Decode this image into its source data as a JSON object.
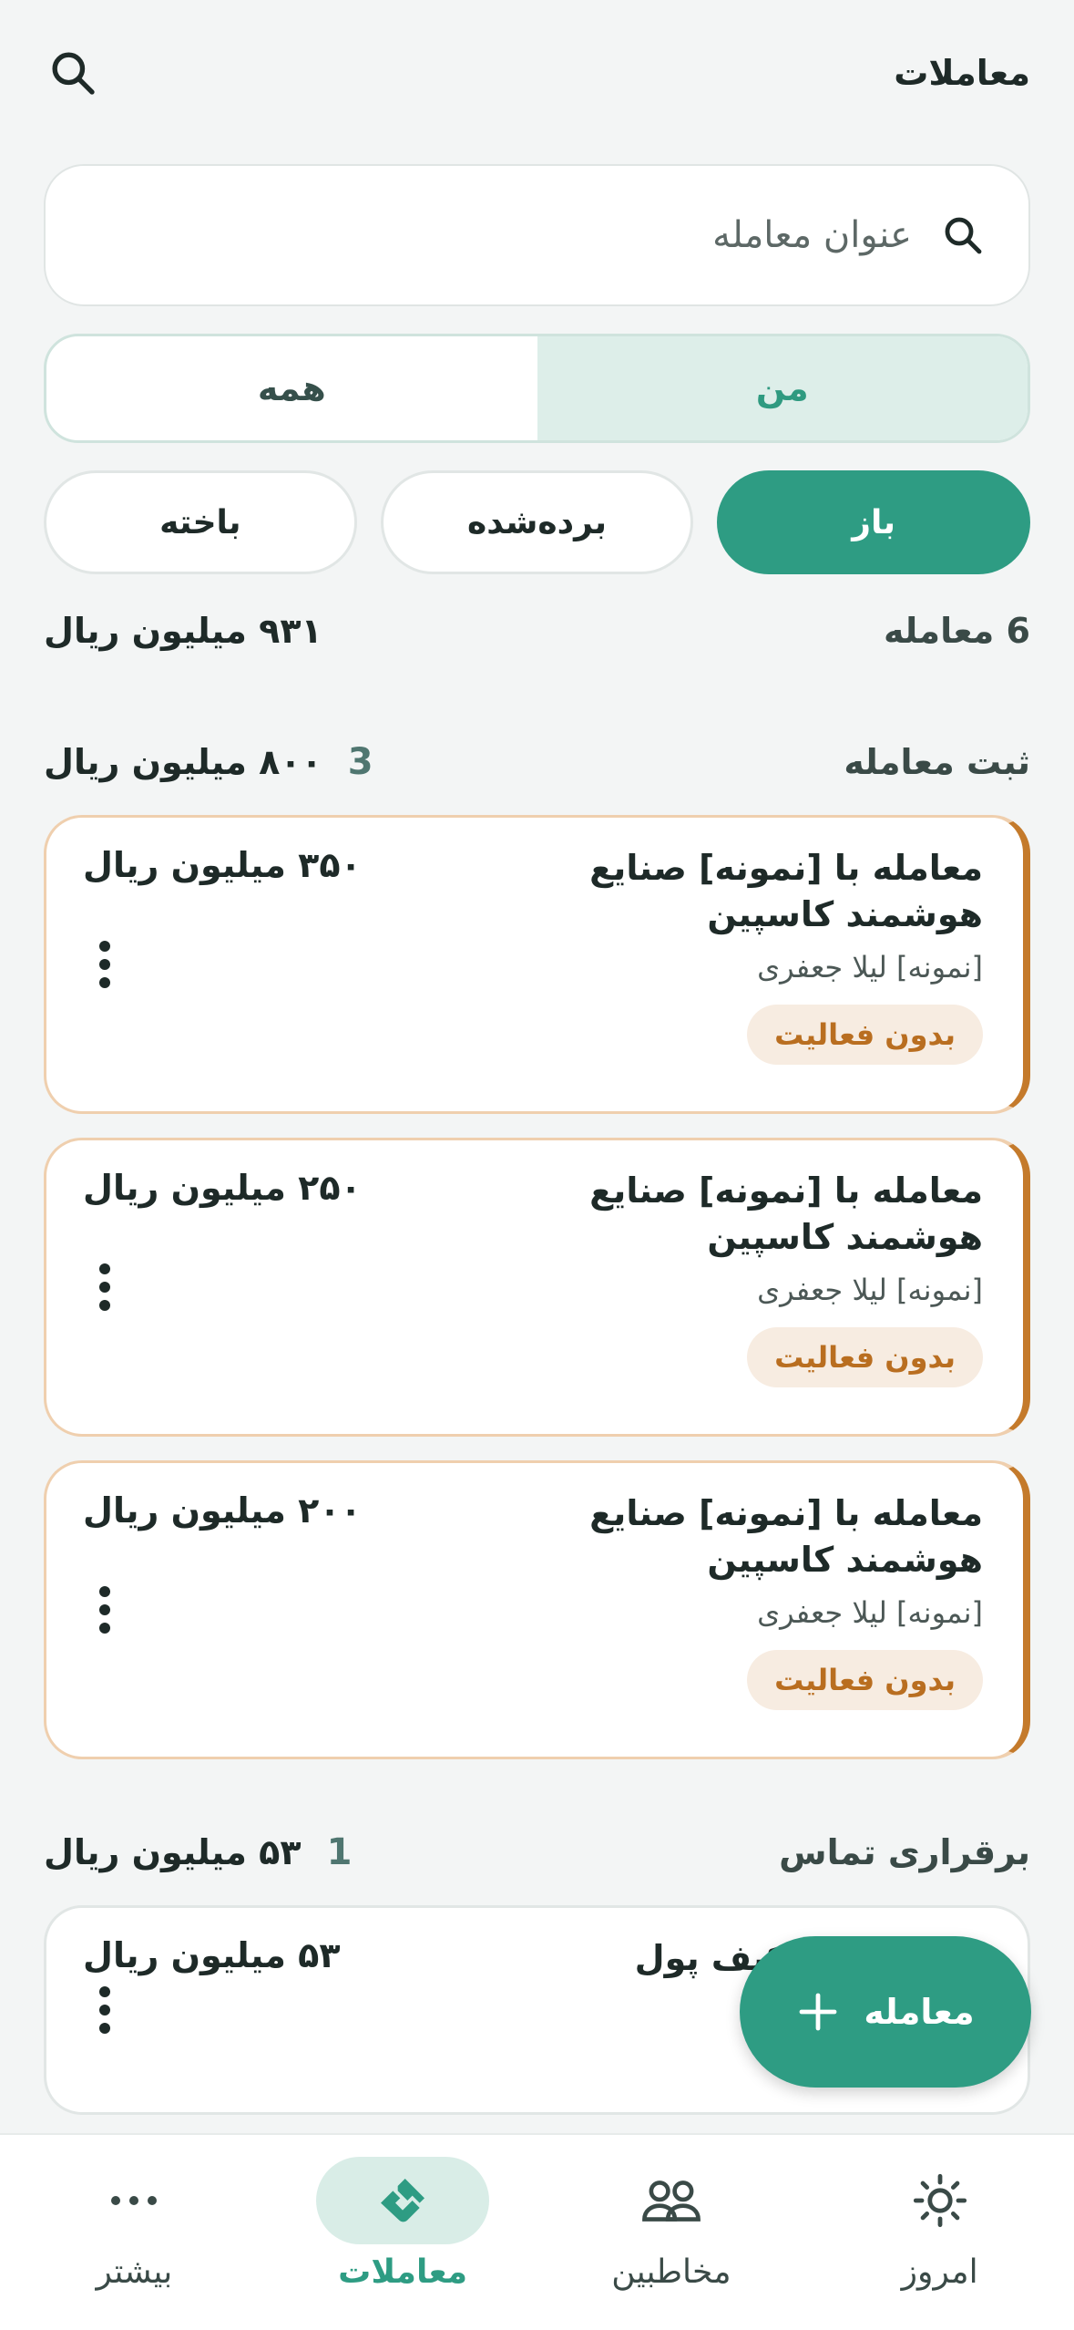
{
  "header": {
    "title": "معاملات"
  },
  "search": {
    "placeholder": "عنوان معامله"
  },
  "segment": {
    "me": "من",
    "all": "همه"
  },
  "filters": {
    "open": "باز",
    "won": "برده‌شده",
    "lost": "باخته"
  },
  "summary": {
    "count": "6 معامله",
    "total": "۹۳۱ میلیون ریال"
  },
  "groups": [
    {
      "title": "ثبت معامله",
      "count": "3",
      "sum": "۸۰۰ میلیون ریال",
      "deals": [
        {
          "title": "معامله با [نمونه] صنایع هوشمند کاسپین",
          "amount": "۳۵۰ میلیون ریال",
          "contact": "[نمونه] لیلا جعفری",
          "status": "بدون فعالیت"
        },
        {
          "title": "معامله با [نمونه] صنایع هوشمند کاسپین",
          "amount": "۲۵۰ میلیون ریال",
          "contact": "[نمونه] لیلا جعفری",
          "status": "بدون فعالیت"
        },
        {
          "title": "معامله با [نمونه] صنایع هوشمند کاسپین",
          "amount": "۲۰۰ میلیون ریال",
          "contact": "[نمونه] لیلا جعفری",
          "status": "بدون فعالیت"
        }
      ]
    },
    {
      "title": "برقراری تماس",
      "count": "1",
      "sum": "۵۳ میلیون ریال",
      "deals": [
        {
          "title": "زی درگاه و کیف پول",
          "amount": "۵۳ میلیون ریال"
        }
      ]
    }
  ],
  "fab": {
    "label": "معامله"
  },
  "nav": {
    "today": "امروز",
    "contacts": "مخاطبین",
    "deals": "معاملات",
    "more": "بیشتر"
  },
  "colors": {
    "accent": "#2e9c83",
    "warning": "#c47a2b"
  }
}
